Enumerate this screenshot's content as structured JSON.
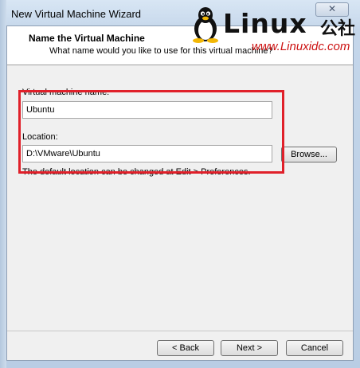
{
  "window": {
    "title": "New Virtual Machine Wizard",
    "close_label": "✕"
  },
  "watermark": {
    "brand": "Linux",
    "brand_cn": "公社",
    "url": "www.Linuxidc.com"
  },
  "header": {
    "title": "Name the Virtual Machine",
    "subtitle": "What name would you like to use for this virtual machine?"
  },
  "form": {
    "vm_name_label": "Virtual machine name:",
    "vm_name_value": "Ubuntu",
    "location_label": "Location:",
    "location_value": "D:\\VMware\\Ubuntu",
    "browse_label": "Browse...",
    "hint": "The default location can be changed at Edit > Preferences."
  },
  "footer": {
    "back_label": "< Back",
    "next_label": "Next >",
    "cancel_label": "Cancel"
  },
  "colors": {
    "highlight": "#e0202a",
    "url": "#cc1111"
  }
}
